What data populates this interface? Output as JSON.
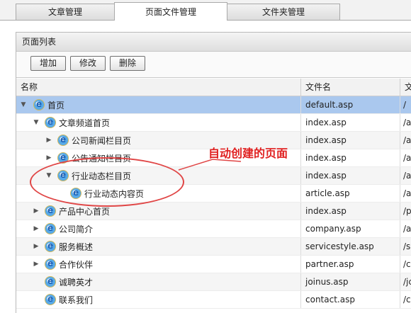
{
  "tabs": [
    {
      "label": "文章管理",
      "active": false
    },
    {
      "label": "页面文件管理",
      "active": true
    },
    {
      "label": "文件夹管理",
      "active": false
    }
  ],
  "panel": {
    "title": "页面列表",
    "buttons": [
      "增加",
      "修改",
      "删除"
    ]
  },
  "table": {
    "headers": [
      "名称",
      "文件名",
      "文"
    ],
    "rows": [
      {
        "name": "首页",
        "file": "default.asp",
        "path": "/"
      },
      {
        "name": "文章频道首页",
        "file": "index.asp",
        "path": "/a"
      },
      {
        "name": "公司新闻栏目页",
        "file": "index.asp",
        "path": "/a"
      },
      {
        "name": "公告通知栏目页",
        "file": "index.asp",
        "path": "/a"
      },
      {
        "name": "行业动态栏目页",
        "file": "index.asp",
        "path": "/a"
      },
      {
        "name": "行业动态内容页",
        "file": "article.asp",
        "path": "/a"
      },
      {
        "name": "产品中心首页",
        "file": "index.asp",
        "path": "/p"
      },
      {
        "name": "公司简介",
        "file": "company.asp",
        "path": "/a"
      },
      {
        "name": "服务概述",
        "file": "servicestyle.asp",
        "path": "/s"
      },
      {
        "name": "合作伙伴",
        "file": "partner.asp",
        "path": "/c"
      },
      {
        "name": "诚聘英才",
        "file": "joinus.asp",
        "path": "/jc"
      },
      {
        "name": "联系我们",
        "file": "contact.asp",
        "path": "/c"
      }
    ]
  },
  "annotation": {
    "text": "自动创建的页面",
    "color": "#e02020"
  },
  "colors": {
    "selected_row": "#aac8ee",
    "accent_border": "#a9a9a9"
  }
}
